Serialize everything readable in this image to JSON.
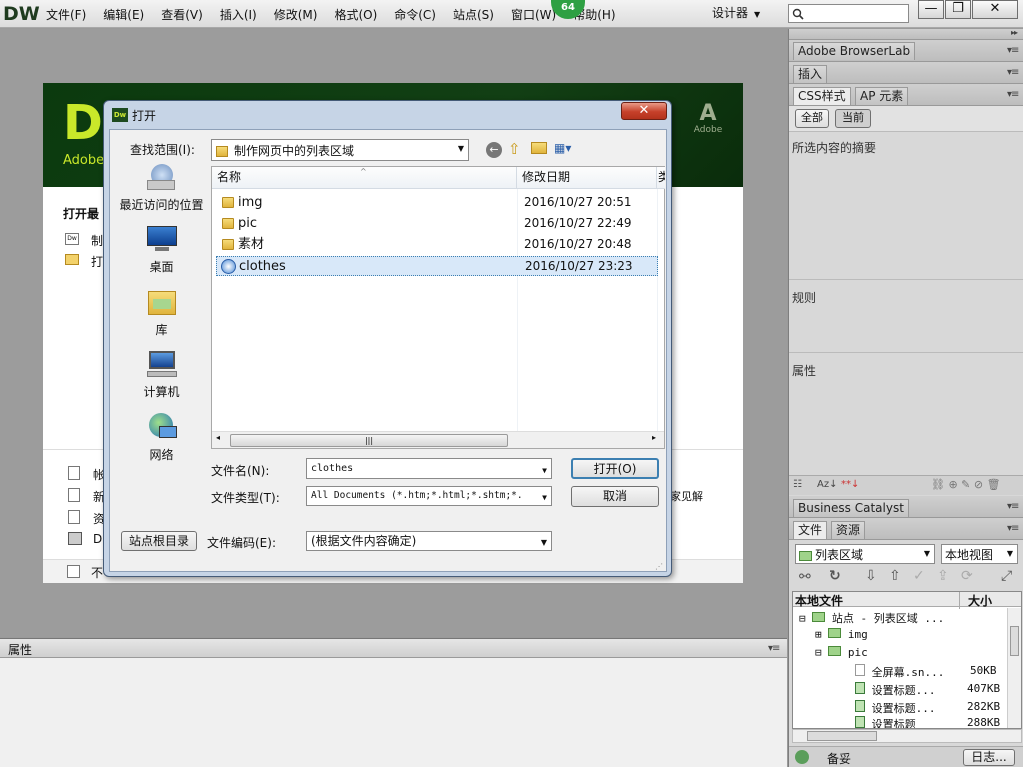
{
  "app": {
    "logo": "DW",
    "menus": [
      "文件(F)",
      "编辑(E)",
      "查看(V)",
      "插入(I)",
      "修改(M)",
      "格式(O)",
      "命令(C)",
      "站点(S)",
      "窗口(W)",
      "帮助(H)"
    ],
    "badge": "64",
    "workspace": "设计器",
    "window_min": "—",
    "window_max": "❐",
    "window_close": "✕"
  },
  "welcome": {
    "big": "Dw",
    "brand": "Adobe",
    "adobe_mark": "Adobe",
    "open_recent": "打开最",
    "item1": "制",
    "item2": "打",
    "create1": "帐",
    "create2": "新",
    "create3": "资",
    "create4": "D",
    "tip_right": "家见解",
    "dont_show": "不"
  },
  "properties": {
    "title": "属性"
  },
  "panels": {
    "browserlab": "Adobe BrowserLab",
    "insert": "插入",
    "css_tab": "CSS样式",
    "ap_tab": "AP 元素",
    "all_btn": "全部",
    "current_btn": "当前",
    "section_summary": "所选内容的摘要",
    "section_rules": "规则",
    "section_props": "属性",
    "az_label": "Az↓",
    "bc": "Business Catalyst",
    "files_tab": "文件",
    "assets_tab": "资源",
    "site_select": "列表区域",
    "view_select": "本地视图",
    "local_files": "本地文件",
    "size_col": "大小",
    "tree": [
      {
        "label": "站点 - 列表区域 ...",
        "size": ""
      },
      {
        "label": "img",
        "size": ""
      },
      {
        "label": "pic",
        "size": ""
      },
      {
        "label": "全屏幕.sn...",
        "size": "50KB"
      },
      {
        "label": "设置标题...",
        "size": "407KB"
      },
      {
        "label": "设置标题...",
        "size": "282KB"
      },
      {
        "label": "设置标题",
        "size": "288KB"
      }
    ],
    "status": "备妥",
    "log_btn": "日志..."
  },
  "dialog": {
    "title": "打开",
    "close": "✕",
    "lookin_label": "查找范围(I):",
    "lookin_value": "制作网页中的列表区域",
    "places": [
      "最近访问的位置",
      "桌面",
      "库",
      "计算机",
      "网络"
    ],
    "col_name": "名称",
    "col_date": "修改日期",
    "col_extra": "类",
    "files": [
      {
        "name": "img",
        "date": "2016/10/27 20:51",
        "type": "folder",
        "selected": false
      },
      {
        "name": "pic",
        "date": "2016/10/27 22:49",
        "type": "folder",
        "selected": false
      },
      {
        "name": "素材",
        "date": "2016/10/27 20:48",
        "type": "folder",
        "selected": false
      },
      {
        "name": "clothes",
        "date": "2016/10/27 23:23",
        "type": "site",
        "selected": true
      }
    ],
    "filename_label": "文件名(N):",
    "filename_value": "clothes",
    "filetype_label": "文件类型(T):",
    "filetype_value": "All Documents (*.htm;*.html;*.shtm;*.",
    "open_btn": "打开(O)",
    "cancel_btn": "取消",
    "site_root_btn": "站点根目录",
    "encoding_label": "文件编码(E):",
    "encoding_value": "(根据文件内容确定)"
  }
}
